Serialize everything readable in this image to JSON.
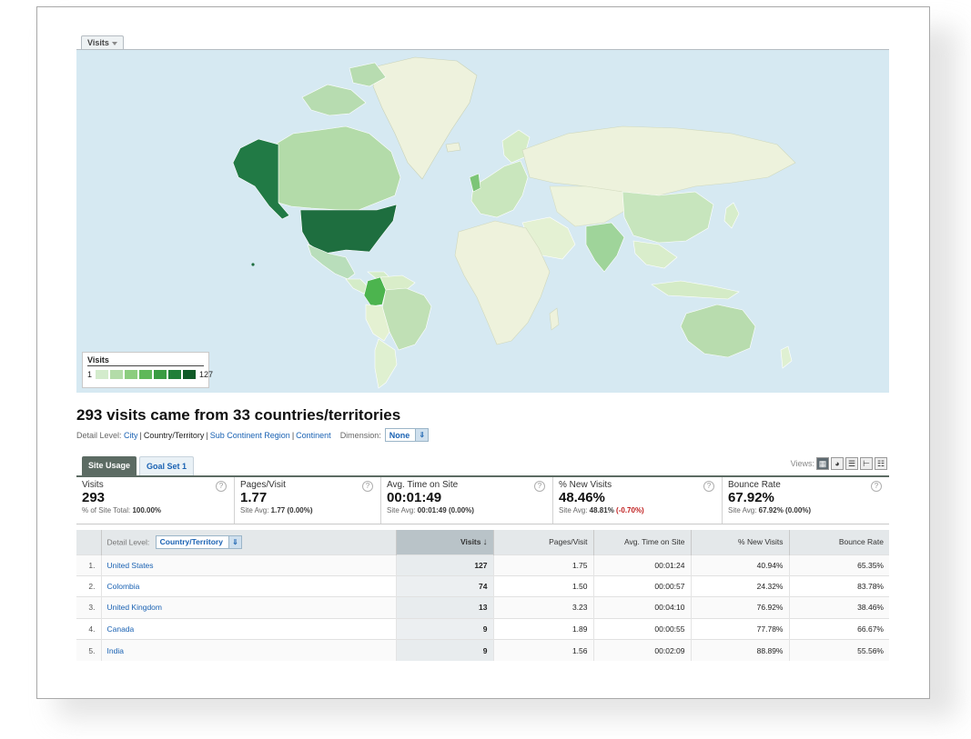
{
  "map": {
    "metric_tab": "Visits",
    "legend": {
      "title": "Visits",
      "min": "1",
      "max": "127",
      "colors": [
        "#d3ebcc",
        "#b3dca8",
        "#8ccd7f",
        "#5fb85a",
        "#3a9c42",
        "#217f38",
        "#0f5a27"
      ]
    }
  },
  "headline": "293 visits came from 33 countries/territories",
  "detail_level": {
    "label": "Detail Level:",
    "options": [
      "City",
      "Country/Territory",
      "Sub Continent Region",
      "Continent"
    ],
    "active": "Country/Territory",
    "dimension_label": "Dimension:",
    "dimension_value": "None"
  },
  "tabs": [
    "Site Usage",
    "Goal Set 1"
  ],
  "views_label": "Views:",
  "scorecards": [
    {
      "label": "Visits",
      "value": "293",
      "sub_label": "% of Site Total:",
      "sub_value": "100.00%",
      "sub_delta": ""
    },
    {
      "label": "Pages/Visit",
      "value": "1.77",
      "sub_label": "Site Avg:",
      "sub_value": "1.77",
      "sub_delta": "(0.00%)"
    },
    {
      "label": "Avg. Time on Site",
      "value": "00:01:49",
      "sub_label": "Site Avg:",
      "sub_value": "00:01:49",
      "sub_delta": "(0.00%)"
    },
    {
      "label": "% New Visits",
      "value": "48.46%",
      "sub_label": "Site Avg:",
      "sub_value": "48.81%",
      "sub_delta": "(-0.70%)"
    },
    {
      "label": "Bounce Rate",
      "value": "67.92%",
      "sub_label": "Site Avg:",
      "sub_value": "67.92%",
      "sub_delta": "(0.00%)"
    }
  ],
  "table": {
    "detail_label": "Detail Level:",
    "detail_value": "Country/Territory",
    "columns": [
      "Visits",
      "Pages/Visit",
      "Avg. Time on Site",
      "% New Visits",
      "Bounce Rate"
    ],
    "rows": [
      {
        "n": "1.",
        "country": "United States",
        "visits": "127",
        "pages": "1.75",
        "time": "00:01:24",
        "new": "40.94%",
        "bounce": "65.35%"
      },
      {
        "n": "2.",
        "country": "Colombia",
        "visits": "74",
        "pages": "1.50",
        "time": "00:00:57",
        "new": "24.32%",
        "bounce": "83.78%"
      },
      {
        "n": "3.",
        "country": "United Kingdom",
        "visits": "13",
        "pages": "3.23",
        "time": "00:04:10",
        "new": "76.92%",
        "bounce": "38.46%"
      },
      {
        "n": "4.",
        "country": "Canada",
        "visits": "9",
        "pages": "1.89",
        "time": "00:00:55",
        "new": "77.78%",
        "bounce": "66.67%"
      },
      {
        "n": "5.",
        "country": "India",
        "visits": "9",
        "pages": "1.56",
        "time": "00:02:09",
        "new": "88.89%",
        "bounce": "55.56%"
      }
    ]
  }
}
